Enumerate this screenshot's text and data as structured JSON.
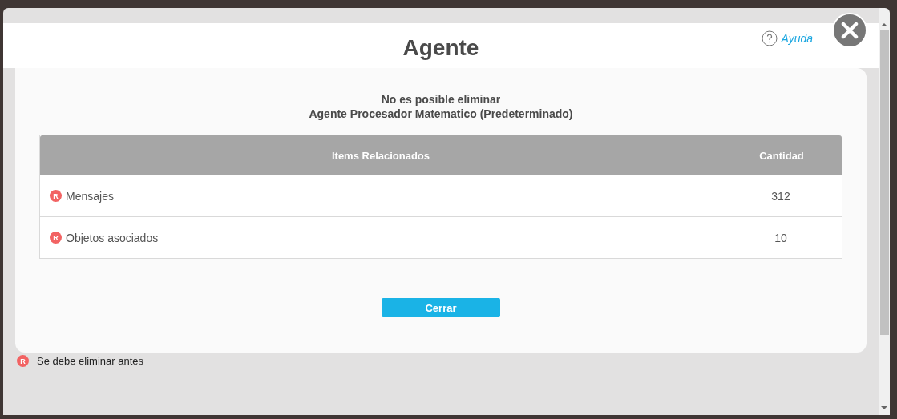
{
  "dialog": {
    "title": "Agente",
    "help_link": "Ayuda"
  },
  "message": {
    "line_1": "No es posible eliminar",
    "line_2": "Agente Procesador Matematico (Predeterminado)"
  },
  "table": {
    "columns": [
      "Items Relacionados",
      "Cantidad"
    ],
    "rows": [
      {
        "badge": "R",
        "item": "Mensajes",
        "count": "312"
      },
      {
        "badge": "R",
        "item": "Objetos asociados",
        "count": "10"
      }
    ]
  },
  "buttons": [
    "Cerrar"
  ],
  "legend": {
    "badge": "R",
    "text": "Se debe eliminar antes"
  }
}
